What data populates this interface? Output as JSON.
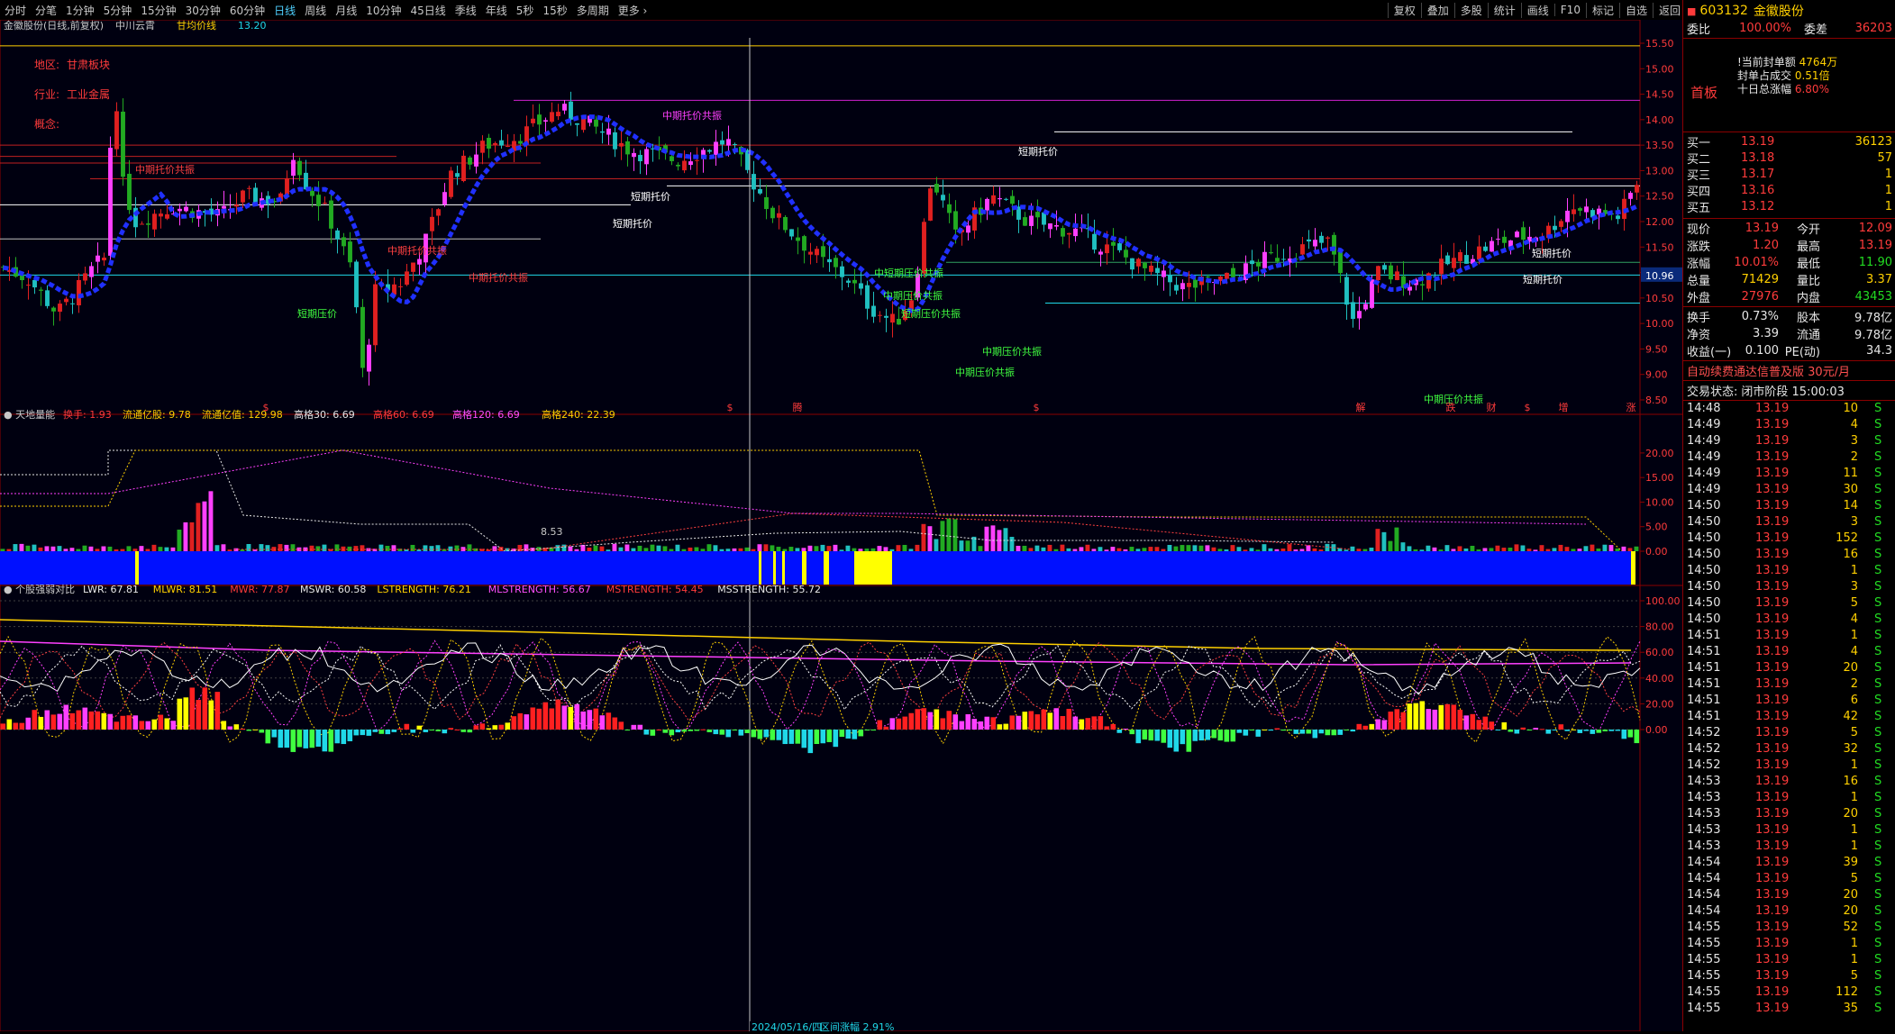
{
  "toolbar": {
    "left_items": [
      "分时",
      "分笔",
      "1分钟",
      "5分钟",
      "15分钟",
      "30分钟",
      "60分钟",
      "日线",
      "周线",
      "月线",
      "10分钟",
      "45日线",
      "季线",
      "年线",
      "5秒",
      "15秒",
      "多周期",
      "更多"
    ],
    "active": "日线",
    "right_items": [
      "复权",
      "叠加",
      "多股",
      "统计",
      "画线",
      "F10",
      "标记",
      "自选",
      "返回"
    ]
  },
  "main_chart": {
    "title": "金徽股份(日线,前复权)",
    "indicator_tags": [
      "中川云霄",
      "甘均价线"
    ],
    "indicator_value": "13.20",
    "info_lines": [
      {
        "label": "地区:",
        "value": "甘肃板块"
      },
      {
        "label": "行业:",
        "value": "工业金属"
      },
      {
        "label": "概念:",
        "value": ""
      }
    ],
    "price_axis": [
      "15.50",
      "15.00",
      "14.50",
      "14.00",
      "13.50",
      "13.00",
      "12.50",
      "12.00",
      "11.50",
      "11.00",
      "10.50",
      "10.00",
      "9.50",
      "9.00",
      "8.50"
    ],
    "current_price_label": "10.96",
    "low_label": "8.53",
    "annotations": [
      "中期托价共振",
      "中期托价共振",
      "中期托价共振",
      "短期托价",
      "短期托价",
      "短期压价",
      "中期托价共振",
      "短期托价",
      "中短期压价共振",
      "中期压价共振",
      "短期压价共振",
      "中期压价共振",
      "短期托价",
      "短期托价",
      "中期压价共振",
      "中期压价共振"
    ],
    "event_markers": [
      "$",
      "$",
      "腾",
      "$",
      "解",
      "跌",
      "财",
      "$",
      "增",
      "涨"
    ]
  },
  "sub_chart1": {
    "title": "天地量能",
    "items": [
      {
        "label": "换手",
        "value": "1.93",
        "color": "#ff3b3b"
      },
      {
        "label": "流通亿股",
        "value": "9.78",
        "color": "#ffd000"
      },
      {
        "label": "流通亿值",
        "value": "129.98",
        "color": "#ffd000"
      },
      {
        "label": "高格30",
        "value": "6.69",
        "color": "#e6e6e6"
      },
      {
        "label": "高格60",
        "value": "6.69",
        "color": "#ff3b3b"
      },
      {
        "label": "高格120",
        "value": "6.69",
        "color": "#ff4fff"
      },
      {
        "label": "高格240",
        "value": "22.39",
        "color": "#ffd000"
      }
    ],
    "axis": [
      "20.00",
      "15.00",
      "10.00",
      "5.00",
      "0.00"
    ]
  },
  "sub_chart2": {
    "title": "个股强弱对比",
    "items": [
      {
        "label": "LWR",
        "value": "67.81",
        "color": "#e6e6e6"
      },
      {
        "label": "MLWR",
        "value": "81.51",
        "color": "#ffd000"
      },
      {
        "label": "MWR",
        "value": "77.87",
        "color": "#ff3b3b"
      },
      {
        "label": "MSWR",
        "value": "60.58",
        "color": "#e6e6e6"
      },
      {
        "label": "LSTRENGTH",
        "value": "76.21",
        "color": "#ffd000"
      },
      {
        "label": "MLSTRENGTH",
        "value": "56.67",
        "color": "#ff4fff"
      },
      {
        "label": "MSTRENGTH",
        "value": "54.45",
        "color": "#ff3b3b"
      },
      {
        "label": "MSSTRENGTH",
        "value": "55.72",
        "color": "#e6e6e6"
      }
    ],
    "axis": [
      "100.00",
      "80.00",
      "60.00",
      "40.00",
      "20.00",
      "0.00"
    ]
  },
  "cursor_date": "2024/05/16/四",
  "cursor_note": "区间涨幅 2.91%",
  "panel": {
    "code": "603132",
    "name": "金徽股份",
    "weibi_label": "委比",
    "weibi_value": "100.00%",
    "weicha_label": "委差",
    "weicha_value": "36203",
    "status_tag": "首板",
    "seal_lines": [
      {
        "label": "!当前封单额",
        "value": "4764万"
      },
      {
        "label": "封单占成交",
        "value": "0.51倍"
      },
      {
        "label": "十日总涨幅",
        "value": "6.80%"
      }
    ],
    "bids": [
      {
        "label": "买一",
        "price": "13.19",
        "vol": "36123"
      },
      {
        "label": "买二",
        "price": "13.18",
        "vol": "57"
      },
      {
        "label": "买三",
        "price": "13.17",
        "vol": "1"
      },
      {
        "label": "买四",
        "price": "13.16",
        "vol": "1"
      },
      {
        "label": "买五",
        "price": "13.12",
        "vol": "1"
      }
    ],
    "quote": [
      {
        "l1": "现价",
        "v1": "13.19",
        "l2": "今开",
        "v2": "12.09"
      },
      {
        "l1": "涨跌",
        "v1": "1.20",
        "l2": "最高",
        "v2": "13.19"
      },
      {
        "l1": "涨幅",
        "v1": "10.01%",
        "l2": "最低",
        "v2": "11.90"
      },
      {
        "l1": "总量",
        "v1": "71429",
        "l2": "量比",
        "v2": "3.37"
      },
      {
        "l1": "外盘",
        "v1": "27976",
        "l2": "内盘",
        "v2": "43453"
      }
    ],
    "fundamentals": [
      {
        "l1": "换手",
        "v1": "0.73%",
        "l2": "股本",
        "v2": "9.78亿"
      },
      {
        "l1": "净资",
        "v1": "3.39",
        "l2": "流通",
        "v2": "9.78亿"
      },
      {
        "l1": "收益(一)",
        "v1": "0.100",
        "l2": "PE(动)",
        "v2": "34.3"
      }
    ],
    "ad_text": "自动续费通达信普及版 30元/月",
    "trade_status_label": "交易状态:",
    "trade_status_value": "闭市阶段 15:00:03",
    "ticks": [
      {
        "t": "14:48",
        "p": "13.19",
        "v": "10",
        "s": "S"
      },
      {
        "t": "14:49",
        "p": "13.19",
        "v": "4",
        "s": "S"
      },
      {
        "t": "14:49",
        "p": "13.19",
        "v": "3",
        "s": "S"
      },
      {
        "t": "14:49",
        "p": "13.19",
        "v": "2",
        "s": "S"
      },
      {
        "t": "14:49",
        "p": "13.19",
        "v": "11",
        "s": "S"
      },
      {
        "t": "14:49",
        "p": "13.19",
        "v": "30",
        "s": "S"
      },
      {
        "t": "14:50",
        "p": "13.19",
        "v": "14",
        "s": "S"
      },
      {
        "t": "14:50",
        "p": "13.19",
        "v": "3",
        "s": "S"
      },
      {
        "t": "14:50",
        "p": "13.19",
        "v": "152",
        "s": "S"
      },
      {
        "t": "14:50",
        "p": "13.19",
        "v": "16",
        "s": "S"
      },
      {
        "t": "14:50",
        "p": "13.19",
        "v": "1",
        "s": "S"
      },
      {
        "t": "14:50",
        "p": "13.19",
        "v": "3",
        "s": "S"
      },
      {
        "t": "14:50",
        "p": "13.19",
        "v": "5",
        "s": "S"
      },
      {
        "t": "14:50",
        "p": "13.19",
        "v": "4",
        "s": "S"
      },
      {
        "t": "14:51",
        "p": "13.19",
        "v": "1",
        "s": "S"
      },
      {
        "t": "14:51",
        "p": "13.19",
        "v": "4",
        "s": "S"
      },
      {
        "t": "14:51",
        "p": "13.19",
        "v": "20",
        "s": "S"
      },
      {
        "t": "14:51",
        "p": "13.19",
        "v": "2",
        "s": "S"
      },
      {
        "t": "14:51",
        "p": "13.19",
        "v": "6",
        "s": "S"
      },
      {
        "t": "14:51",
        "p": "13.19",
        "v": "42",
        "s": "S"
      },
      {
        "t": "14:52",
        "p": "13.19",
        "v": "5",
        "s": "S"
      },
      {
        "t": "14:52",
        "p": "13.19",
        "v": "32",
        "s": "S"
      },
      {
        "t": "14:52",
        "p": "13.19",
        "v": "1",
        "s": "S"
      },
      {
        "t": "14:53",
        "p": "13.19",
        "v": "16",
        "s": "S"
      },
      {
        "t": "14:53",
        "p": "13.19",
        "v": "1",
        "s": "S"
      },
      {
        "t": "14:53",
        "p": "13.19",
        "v": "20",
        "s": "S"
      },
      {
        "t": "14:53",
        "p": "13.19",
        "v": "1",
        "s": "S"
      },
      {
        "t": "14:53",
        "p": "13.19",
        "v": "1",
        "s": "S"
      },
      {
        "t": "14:54",
        "p": "13.19",
        "v": "39",
        "s": "S"
      },
      {
        "t": "14:54",
        "p": "13.19",
        "v": "5",
        "s": "S"
      },
      {
        "t": "14:54",
        "p": "13.19",
        "v": "20",
        "s": "S"
      },
      {
        "t": "14:54",
        "p": "13.19",
        "v": "20",
        "s": "S"
      },
      {
        "t": "14:55",
        "p": "13.19",
        "v": "52",
        "s": "S"
      },
      {
        "t": "14:55",
        "p": "13.19",
        "v": "1",
        "s": "S"
      },
      {
        "t": "14:55",
        "p": "13.19",
        "v": "1",
        "s": "S"
      },
      {
        "t": "14:55",
        "p": "13.19",
        "v": "5",
        "s": "S"
      },
      {
        "t": "14:55",
        "p": "13.19",
        "v": "112",
        "s": "S"
      },
      {
        "t": "14:55",
        "p": "13.19",
        "v": "35",
        "s": "S"
      }
    ]
  }
}
